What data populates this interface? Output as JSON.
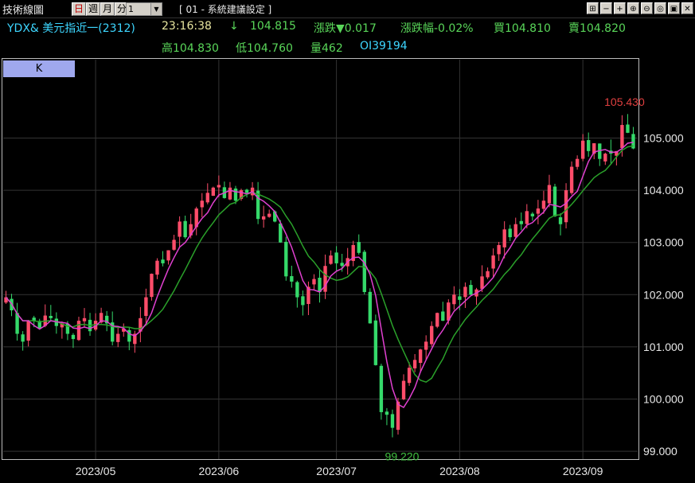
{
  "window": {
    "title": "技術線圖",
    "periods": [
      "日",
      "週",
      "月",
      "分"
    ],
    "active_period": "日",
    "interval_value": "1",
    "strategy_label": "[ 01 - 系統建議設定 ]",
    "buttons": [
      "restore",
      "minimize",
      "zoom-in",
      "zoom-out",
      "zoom-reset",
      "save",
      "close"
    ]
  },
  "quote": {
    "symbol": "YDX& 美元指近一(2312)",
    "time": "23:16:38",
    "arrow": "↓",
    "last": "104.815",
    "change": "漲跌▼0.017",
    "change_pct": "漲跌幅-0.02%",
    "bid": "買104.810",
    "ask": "賣104.820",
    "high": "高104.830",
    "low": "低104.760",
    "volume": "量462",
    "oi": "OI39194"
  },
  "colors": {
    "up": "#ff4d6a",
    "down": "#35d96a",
    "ma_short": "#e040d0",
    "ma_long": "#2aa02a",
    "grid": "#333333",
    "quote_cyan": "#3dd6ff",
    "quote_green": "#59d659",
    "title_yellow": "#e8e6a0",
    "max_label": "#e04040",
    "min_label": "#40c040"
  },
  "chart_panel": {
    "tab_label": "K"
  },
  "chart_data": {
    "type": "candlestick",
    "y_ticks": [
      "105.000",
      "104.000",
      "103.000",
      "102.000",
      "101.000",
      "100.000",
      "99.000"
    ],
    "ylim": [
      98.85,
      106.15
    ],
    "x_labels": [
      "2023/05",
      "2023/06",
      "2023/07",
      "2023/08",
      "2023/09"
    ],
    "x_label_index": [
      16,
      38,
      59,
      81,
      103
    ],
    "max_label": "105.430",
    "min_label": "99.220",
    "closes": [
      101.95,
      101.7,
      101.25,
      101.1,
      101.5,
      101.5,
      101.35,
      101.6,
      101.55,
      101.4,
      101.45,
      101.25,
      101.15,
      101.5,
      101.55,
      101.3,
      101.5,
      101.65,
      101.45,
      101.1,
      101.25,
      101.35,
      101.1,
      101.25,
      101.55,
      101.95,
      102.4,
      102.65,
      102.6,
      102.85,
      103.05,
      103.4,
      103.1,
      103.35,
      103.65,
      103.8,
      103.95,
      104.05,
      104.1,
      103.85,
      104.05,
      103.8,
      104.0,
      103.95,
      104.05,
      103.45,
      103.5,
      103.55,
      103.4,
      103.0,
      102.35,
      102.25,
      101.95,
      101.8,
      102.15,
      102.3,
      102.05,
      102.55,
      102.75,
      102.6,
      102.55,
      102.7,
      102.95,
      102.8,
      102.05,
      101.45,
      100.65,
      99.75,
      99.7,
      99.45,
      99.95,
      100.35,
      100.6,
      100.75,
      100.95,
      101.1,
      101.4,
      101.65,
      101.5,
      101.85,
      102.0,
      101.9,
      102.15,
      102.0,
      102.1,
      102.35,
      102.45,
      102.75,
      102.95,
      103.25,
      103.1,
      103.35,
      103.35,
      103.6,
      103.5,
      103.65,
      103.8,
      104.1,
      103.5,
      103.35,
      104.0,
      104.45,
      104.6,
      104.95,
      104.75,
      104.9,
      104.6,
      104.7,
      104.7,
      104.75,
      105.25,
      105.1,
      104.8
    ]
  }
}
